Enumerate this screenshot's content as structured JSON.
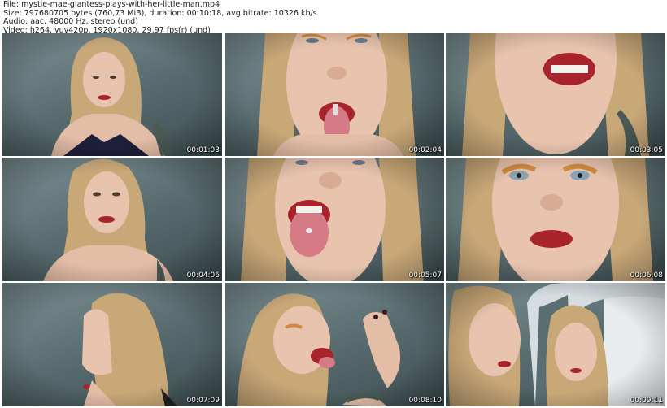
{
  "header": {
    "file_line": "File: mystie-mae-giantess-plays-with-her-little-man.mp4",
    "size_line": "Size: 797680705 bytes (760,73 MiB), duration: 00:10:18, avg.bitrate: 10326 kb/s",
    "audio_line": "Audio: aac, 48000 Hz, stereo (und)",
    "video_line": "Video: h264, yuv420p, 1920x1080, 29,97 fps(r) (und)"
  },
  "thumbnails": [
    {
      "timestamp": "00:01:03"
    },
    {
      "timestamp": "00:02:04"
    },
    {
      "timestamp": "00:03:05"
    },
    {
      "timestamp": "00:04:06"
    },
    {
      "timestamp": "00:05:07"
    },
    {
      "timestamp": "00:06:08"
    },
    {
      "timestamp": "00:07:09"
    },
    {
      "timestamp": "00:08:10"
    },
    {
      "timestamp": "00:09:11"
    }
  ],
  "colors": {
    "background": "#ffffff",
    "wall": "#5a6d70",
    "hair": "#c9a878",
    "skin": "#e8c4ae",
    "lips": "#a8242c",
    "timestamp_text": "#ffffff"
  }
}
